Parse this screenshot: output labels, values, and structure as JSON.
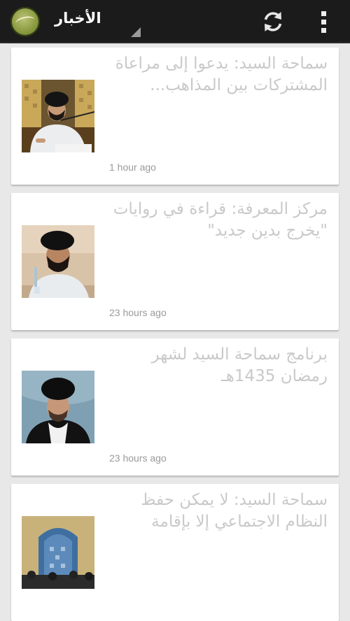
{
  "header": {
    "app_title": "الأخبار",
    "icons": [
      "app-logo-icon",
      "refresh-icon",
      "overflow-menu-icon"
    ]
  },
  "news": [
    {
      "title": "سماحة السيد: يدعوا إلى مراعاة المشتركات بين المذاهب...",
      "time": "1 hour ago"
    },
    {
      "title": "مركز المعرفة: قراءة في روايات \"يخرج بدين جديد\"",
      "time": "23 hours ago"
    },
    {
      "title": "برنامج سماحة السيد لشهر رمضان 1435هـ",
      "time": "23 hours ago"
    },
    {
      "title": "سماحة السيد: لا يمكن حفظ النظام الاجتماعي إلا بإقامة",
      "time": ""
    }
  ],
  "colors": {
    "action_bar": "#1b1b1b",
    "background": "#e8e8e8",
    "card": "#ffffff",
    "title_text": "#c9c9c9",
    "time_text": "#9a9a9a"
  }
}
